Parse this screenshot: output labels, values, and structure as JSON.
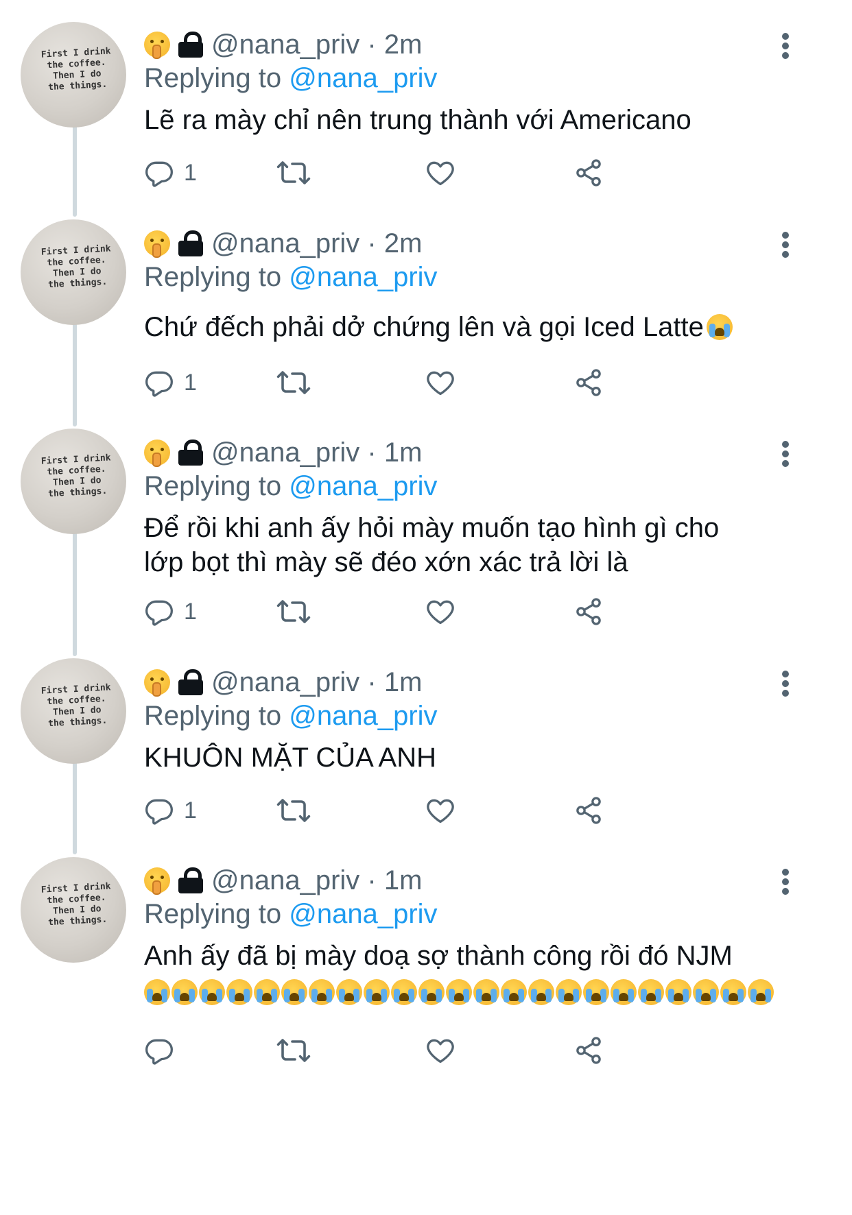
{
  "avatar_caption": "First I drink\nthe coffee.\nThen I do\nthe things.",
  "colors": {
    "text": "#0f1419",
    "secondary": "#536471",
    "mention": "#1d9bf0",
    "thread_line": "#cfd9de"
  },
  "tweets": [
    {
      "handle": "@nana_priv",
      "time": "2m",
      "replying_label": "Replying to",
      "replying_to": "@nana_priv",
      "text": "Lẽ ra mày chỉ nên trung thành với Americano",
      "reply_count": "1"
    },
    {
      "handle": "@nana_priv",
      "time": "2m",
      "replying_label": "Replying to",
      "replying_to": "@nana_priv",
      "text": "Chứ đếch phải dở chứng lên và gọi Iced Latte",
      "reply_count": "1"
    },
    {
      "handle": "@nana_priv",
      "time": "1m",
      "replying_label": "Replying to",
      "replying_to": "@nana_priv",
      "text": "Để rồi khi anh ấy hỏi mày muốn tạo hình gì cho\nlớp bọt thì mày sẽ đéo xớn xác trả lời là",
      "reply_count": "1"
    },
    {
      "handle": "@nana_priv",
      "time": "1m",
      "replying_label": "Replying to",
      "replying_to": "@nana_priv",
      "text": "KHUÔN MẶT CỦA ANH",
      "reply_count": "1"
    },
    {
      "handle": "@nana_priv",
      "time": "1m",
      "replying_label": "Replying to",
      "replying_to": "@nana_priv",
      "text": "Anh ấy đã bị mày doạ sợ thành công rồi đó NJM",
      "reply_count": ""
    }
  ],
  "icons": {
    "status_emoji": "shushing-face-emoji",
    "lock": "lock-icon",
    "more": "more-options-icon",
    "reply": "reply-icon",
    "retweet": "retweet-icon",
    "like": "like-icon",
    "share": "share-icon",
    "crying": "loudly-crying-face-emoji"
  },
  "emoji_row_count": 23
}
